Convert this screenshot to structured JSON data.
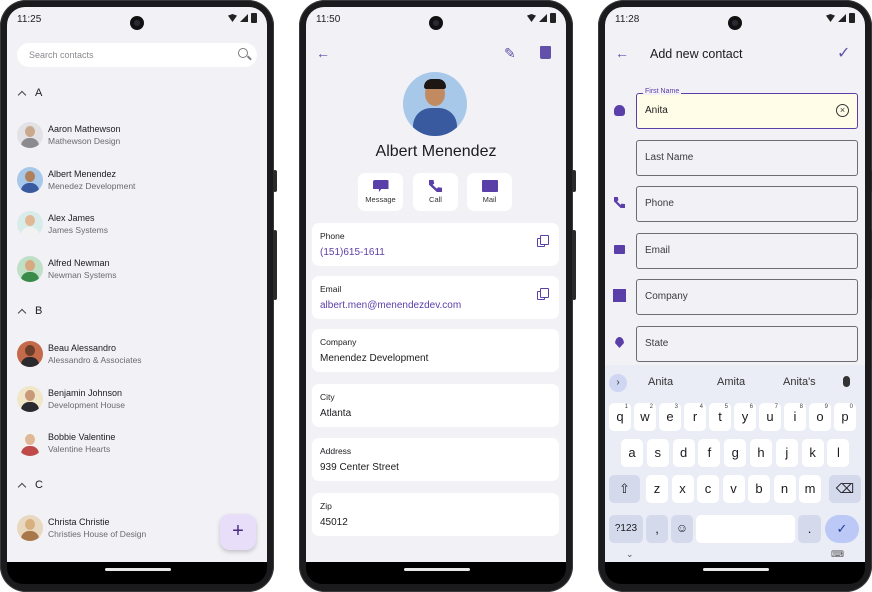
{
  "phone1": {
    "time": "11:25",
    "search_placeholder": "Search contacts",
    "sections": [
      {
        "letter": "A"
      },
      {
        "letter": "B"
      },
      {
        "letter": "C"
      }
    ],
    "contacts": [
      {
        "name": "Aaron Mathewson",
        "company": "Mathewson Design"
      },
      {
        "name": "Albert Menendez",
        "company": "Menedez Development"
      },
      {
        "name": "Alex James",
        "company": "James Systems"
      },
      {
        "name": "Alfred Newman",
        "company": "Newman Systems"
      },
      {
        "name": "Beau Alessandro",
        "company": "Alessandro & Associates"
      },
      {
        "name": "Benjamin Johnson",
        "company": "Development House"
      },
      {
        "name": "Bobbie Valentine",
        "company": "Valentine Hearts"
      },
      {
        "name": "Christa Christie",
        "company": "Christies House of Design"
      }
    ],
    "fab_label": "+"
  },
  "phone2": {
    "time": "11:50",
    "name": "Albert Menendez",
    "actions": [
      {
        "label": "Message",
        "icon": "message-icon"
      },
      {
        "label": "Call",
        "icon": "phone-icon"
      },
      {
        "label": "Mail",
        "icon": "mail-icon"
      }
    ],
    "details": [
      {
        "label": "Phone",
        "value": "(151)615-1611"
      },
      {
        "label": "Email",
        "value": "albert.men@menendezdev.com"
      },
      {
        "label": "Company",
        "value": "Menendez Development"
      },
      {
        "label": "City",
        "value": "Atlanta"
      },
      {
        "label": "Address",
        "value": "939 Center Street"
      },
      {
        "label": "Zip",
        "value": "45012"
      }
    ]
  },
  "phone3": {
    "time": "11:28",
    "title": "Add new contact",
    "first_name_label": "First Name",
    "first_name_value": "Anita",
    "fields": [
      {
        "placeholder": "Last Name"
      },
      {
        "placeholder": "Phone"
      },
      {
        "placeholder": "Email"
      },
      {
        "placeholder": "Company"
      },
      {
        "placeholder": "State"
      }
    ],
    "suggestions": [
      "Anita",
      "Amita",
      "Anita's"
    ],
    "keyboard": {
      "row1": [
        "q",
        "w",
        "e",
        "r",
        "t",
        "y",
        "u",
        "i",
        "o",
        "p"
      ],
      "row1_sup": [
        "1",
        "2",
        "3",
        "4",
        "5",
        "6",
        "7",
        "8",
        "9",
        "0"
      ],
      "row2": [
        "a",
        "s",
        "d",
        "f",
        "g",
        "h",
        "j",
        "k",
        "l"
      ],
      "row3": [
        "z",
        "x",
        "c",
        "v",
        "b",
        "n",
        "m"
      ],
      "symbols_key": "?123",
      "comma_key": ",",
      "period_key": "."
    }
  },
  "colors": {
    "accent": "#5b3fa8",
    "fab_bg": "#e8defa",
    "screen_bg": "#f1f1f6"
  }
}
